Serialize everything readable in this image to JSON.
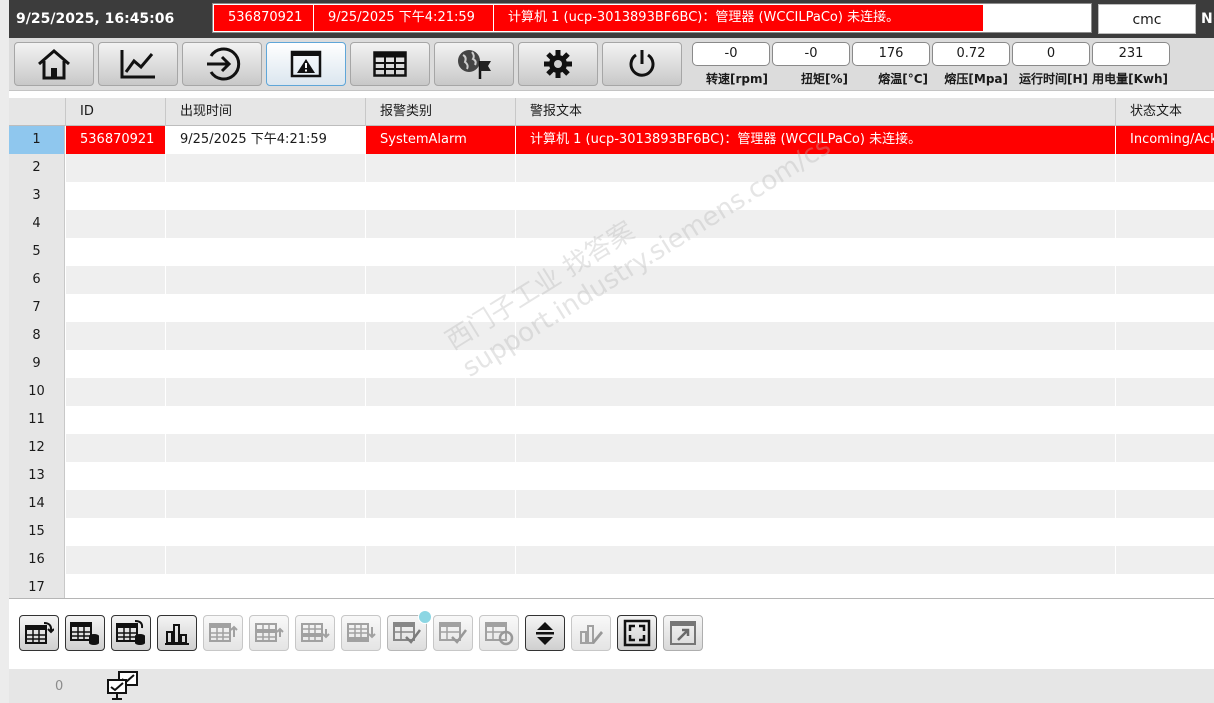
{
  "header": {
    "datetime": "9/25/2025, 16:45:06",
    "alarm": {
      "id": "536870921",
      "time": "9/25/2025 下午4:21:59",
      "text": "计算机 1 (ucp-3013893BF6BC)：管理器 (WCCILPaCo) 未连接。"
    },
    "user": "cmc",
    "edge_text": "N("
  },
  "nav": {
    "buttons": [
      "home-icon",
      "trend-chart-icon",
      "login-arrow-icon",
      "alarm-window-icon",
      "table-icon",
      "globe-flag-icon",
      "gear-icon",
      "power-icon"
    ],
    "active": "alarm-window-icon"
  },
  "readouts": [
    {
      "value": "-0",
      "label": "转速[rpm]"
    },
    {
      "value": "-0",
      "label": "扭矩[%]"
    },
    {
      "value": "176",
      "label": "熔温[°C]"
    },
    {
      "value": "0.72",
      "label": "熔压[Mpa]"
    },
    {
      "value": "0",
      "label": "运行时间[H]"
    },
    {
      "value": "231",
      "label": "用电量[Kwh]"
    }
  ],
  "table": {
    "columns": [
      "ID",
      "出现时间",
      "报警类别",
      "警报文本",
      "状态文本"
    ],
    "rows": [
      {
        "num": "1",
        "id": "536870921",
        "time": "9/25/2025 下午4:21:59",
        "class": "SystemAlarm",
        "text": "计算机 1 (ucp-3013893BF6BC)：管理器 (WCCILPaCo) 未连接。",
        "state": "Incoming/Ack"
      },
      {
        "num": "2"
      },
      {
        "num": "3"
      },
      {
        "num": "4"
      },
      {
        "num": "5"
      },
      {
        "num": "6"
      },
      {
        "num": "7"
      },
      {
        "num": "8"
      },
      {
        "num": "9"
      },
      {
        "num": "10"
      },
      {
        "num": "11"
      },
      {
        "num": "12"
      },
      {
        "num": "13"
      },
      {
        "num": "14"
      },
      {
        "num": "15"
      },
      {
        "num": "16"
      },
      {
        "num": "17"
      }
    ]
  },
  "toolbar": {
    "buttons": [
      "current-alarms-icon",
      "alarm-log-icon",
      "alarm-archive-icon",
      "alarm-statistics-icon",
      "sort-ascending-icon",
      "move-up-icon",
      "move-down-icon",
      "sort-descending-icon",
      "acknowledge-icon",
      "acknowledge-all-icon",
      "loop-in-alarm-icon",
      "scroll-toggle-icon",
      "edit-alarm-icon",
      "fullscreen-icon",
      "export-icon"
    ]
  },
  "status": {
    "count": "0",
    "icon": "computer-check-icon"
  },
  "watermark": {
    "line1": "西门子工业   找答案",
    "line2": "support.industry.siemens.com/cs"
  },
  "colors": {
    "alarm_red": "#ff0000",
    "topbar": "#3c3c3c",
    "selected_row": "#8fc7ee"
  }
}
